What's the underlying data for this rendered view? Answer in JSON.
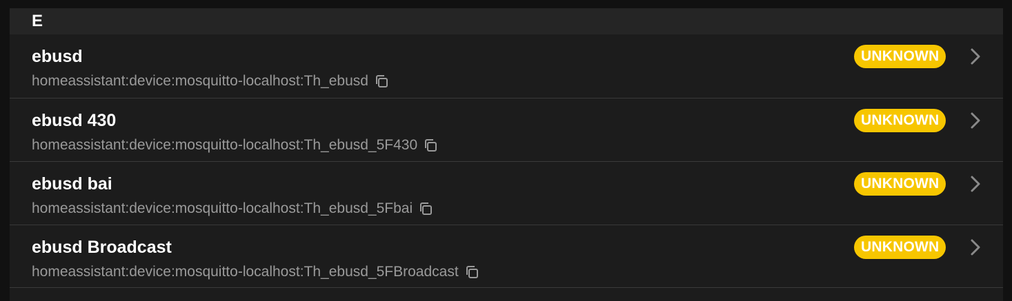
{
  "section": {
    "letter": "E"
  },
  "devices": [
    {
      "name": "ebusd",
      "identifier": "homeassistant:device:mosquitto-localhost:Th_ebusd",
      "status": "UNKNOWN"
    },
    {
      "name": "ebusd 430",
      "identifier": "homeassistant:device:mosquitto-localhost:Th_ebusd_5F430",
      "status": "UNKNOWN"
    },
    {
      "name": "ebusd bai",
      "identifier": "homeassistant:device:mosquitto-localhost:Th_ebusd_5Fbai",
      "status": "UNKNOWN"
    },
    {
      "name": "ebusd Broadcast",
      "identifier": "homeassistant:device:mosquitto-localhost:Th_ebusd_5FBroadcast",
      "status": "UNKNOWN"
    }
  ],
  "icons": {
    "copy": "copy-icon",
    "chevron": "chevron-right-icon"
  },
  "colors": {
    "background": "#111111",
    "panel": "#1c1c1c",
    "header": "#252525",
    "badge": "#f7c600",
    "subtext": "#9a9a9a"
  }
}
